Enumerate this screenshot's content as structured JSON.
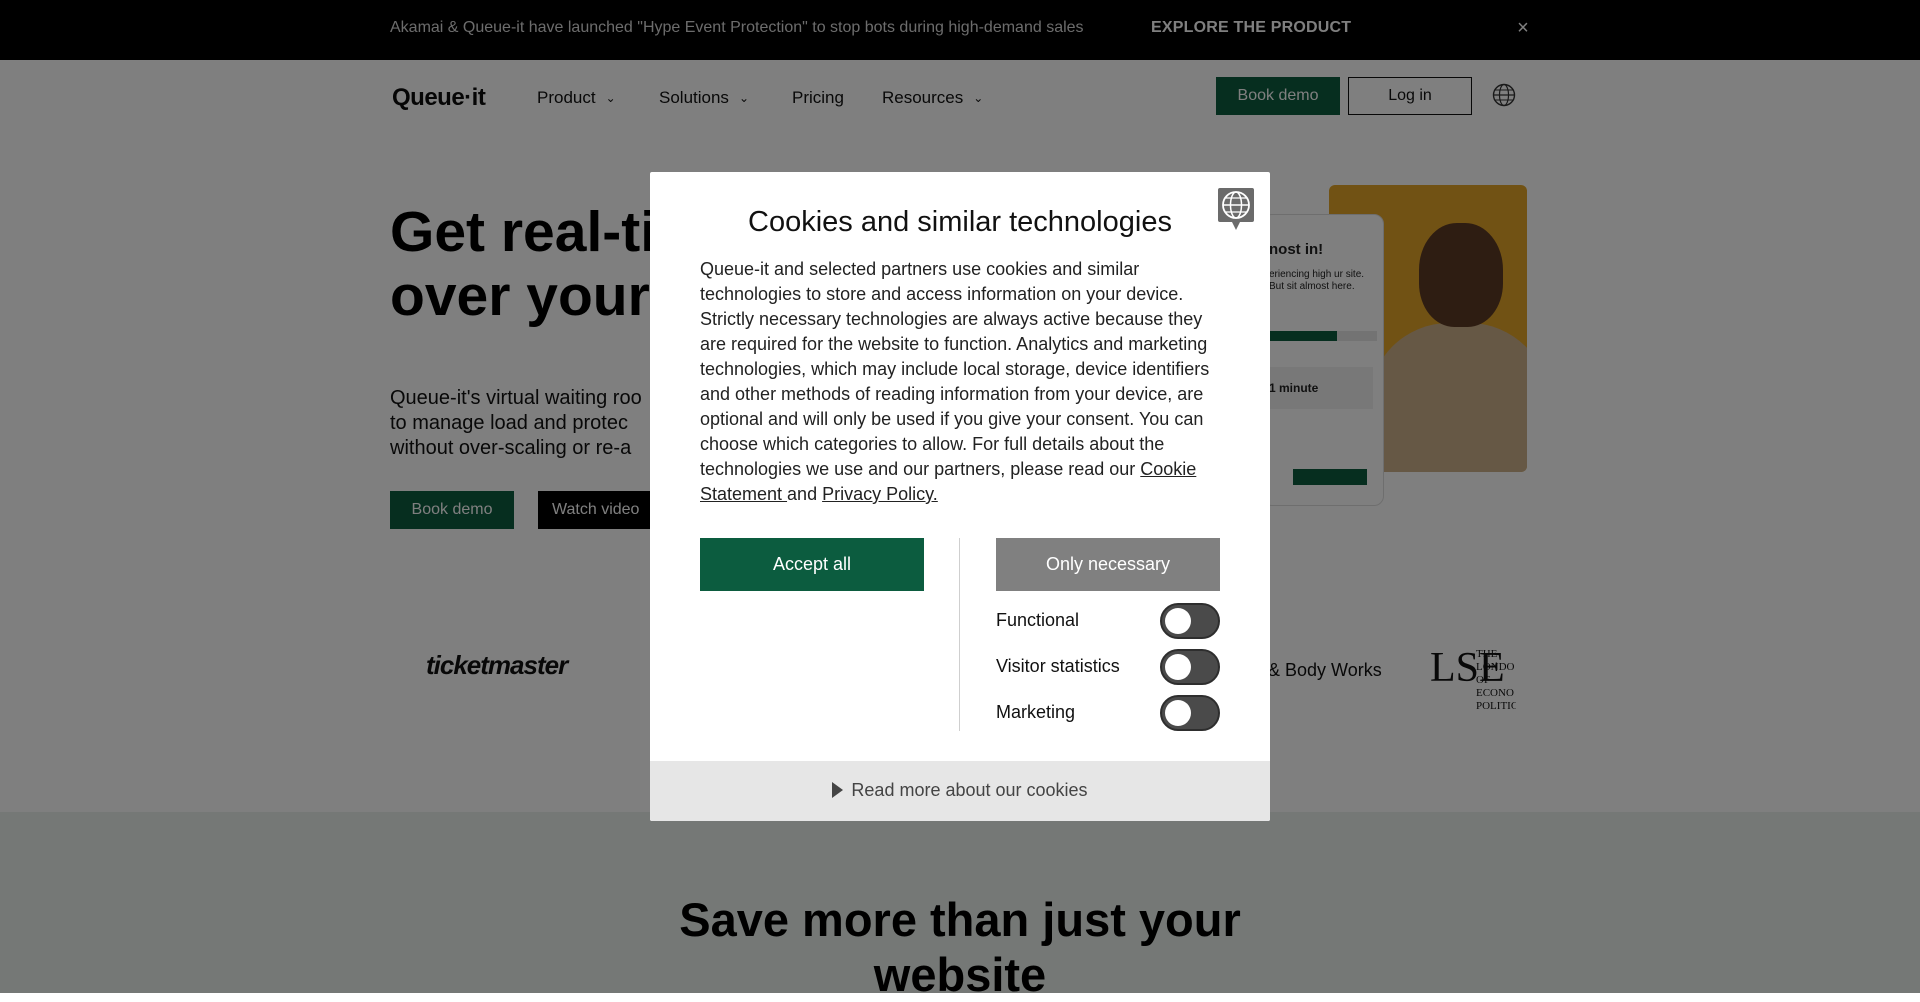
{
  "announcement": {
    "text": "Akamai & Queue-it have launched \"Hype Event Protection\" to stop bots during high-demand sales ",
    "cta": "EXPLORE THE PRODUCT",
    "close_glyph": "×"
  },
  "nav": {
    "logo": "Queue·it",
    "items": [
      {
        "label": "Product",
        "has_menu": true
      },
      {
        "label": "Solutions",
        "has_menu": true
      },
      {
        "label": "Pricing",
        "has_menu": false
      },
      {
        "label": "Resources",
        "has_menu": true
      }
    ],
    "book_demo": "Book demo",
    "login": "Log in",
    "language_icon": "globe-icon"
  },
  "hero": {
    "title_line1": "Get real-ti",
    "title_line2": "over your p",
    "desc_line1": "Queue-it's virtual waiting roo",
    "desc_line2": "to manage load and protec",
    "desc_line3": "without over-scaling or re-a",
    "book_demo": "Book demo",
    "watch_video": "Watch video",
    "phone": {
      "title": "nost in!",
      "text": "eriencing high ur site. But sit almost here.",
      "wait": "1 minute"
    }
  },
  "logos": {
    "ticketmaster": "ticketmaster",
    "bath_body": "& Body Works",
    "lse": "LSE",
    "lse_sub": "THE LONDO OF ECONO POLITICAL"
  },
  "lower": {
    "title_line1": "Save more than just your",
    "title_line2": "website"
  },
  "cookie_modal": {
    "title": "Cookies and similar technologies",
    "body": "Queue-it and selected partners use cookies and similar technologies to store and access information on your device. Strictly necessary technologies are always active because they are required for the website to function. Analytics and marketing technologies, which may include local storage, device identifiers and other methods of reading information from your device, are optional and will only be used if you give your consent. You can choose which categories to allow. For full details about the technologies we use and our partners, please read our ",
    "cookie_statement_link": "Cookie Statement ",
    "and_text": "and ",
    "privacy_link": "Privacy Policy.",
    "accept_all": "Accept all",
    "only_necessary": "Only necessary",
    "toggles": [
      {
        "label": "Functional",
        "enabled": false
      },
      {
        "label": "Visitor statistics",
        "enabled": false
      },
      {
        "label": "Marketing",
        "enabled": false
      }
    ],
    "read_more": "Read more about our cookies"
  },
  "colors": {
    "brand_green": "#0c5c3f",
    "announcement_bg": "#000000",
    "overlay": "rgba(0,0,0,0.5)",
    "necessary_button": "#808080"
  }
}
